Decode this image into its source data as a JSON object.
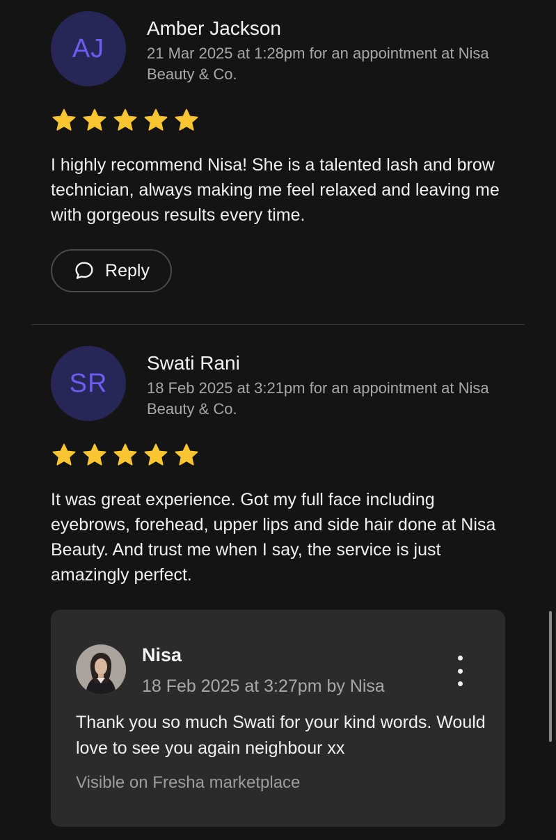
{
  "colors": {
    "background": "#141414",
    "avatar_bg": "#272657",
    "avatar_text": "#6b5df0",
    "star": "#f9c531",
    "card_bg": "#2b2b2b",
    "muted_text": "#a8a8a8"
  },
  "reviews": [
    {
      "initials": "AJ",
      "name": "Amber Jackson",
      "meta": "21 Mar 2025 at 1:28pm for an appointment at Nisa Beauty & Co.",
      "rating": 5,
      "text": "I highly recommend Nisa! She is a talented lash and brow technician, always making me feel relaxed and leaving me with gorgeous results every time.",
      "reply_button_label": "Reply",
      "reply_icon": "speech-bubble-icon"
    },
    {
      "initials": "SR",
      "name": "Swati Rani",
      "meta": "18 Feb 2025 at 3:21pm for an appointment at Nisa Beauty & Co.",
      "rating": 5,
      "text": "It was great experience. Got my full face including eyebrows, forehead, upper lips and side hair done at Nisa Beauty. And trust me when I say, the service is just amazingly perfect.",
      "business_reply": {
        "name": "Nisa",
        "meta": "18 Feb 2025 at 3:27pm by Nisa",
        "text": "Thank you so much Swati for your kind words. Would love to see you again neighbour xx",
        "visibility": "Visible on Fresha marketplace",
        "menu_icon": "vertical-dots-icon"
      }
    }
  ]
}
